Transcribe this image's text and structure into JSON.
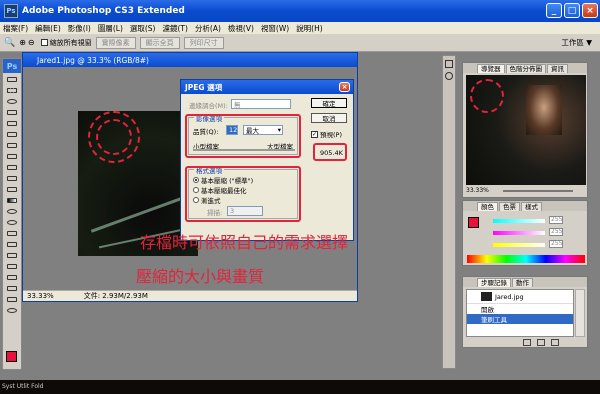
{
  "app": {
    "title": "Adobe Photoshop CS3 Extended"
  },
  "menu": [
    "檔案(F)",
    "編輯(E)",
    "影像(I)",
    "圖層(L)",
    "選取(S)",
    "濾鏡(T)",
    "分析(A)",
    "檢視(V)",
    "視窗(W)",
    "說明(H)"
  ],
  "options": {
    "auto_resize_label": "縮放所有視窗",
    "buttons": [
      "實際像素",
      "顯示全頁",
      "列印尺寸"
    ],
    "workspace": "工作區 ▼"
  },
  "document": {
    "title": "Jared1.jpg @ 33.3% (RGB/8#)",
    "zoom": "33.33%",
    "doc_info": "文件: 2.93M/2.93M"
  },
  "jpeg_dialog": {
    "title": "JPEG 選項",
    "matte_label": "邊緣調合(M):",
    "matte_value": "無",
    "image_options": "影像選項",
    "quality_label": "品質(Q):",
    "quality_value": "12",
    "quality_preset": "最大",
    "small_file": "小型檔案",
    "large_file": "大型檔案",
    "format_options": "格式選項",
    "baseline_standard": "基本壓縮 (\"標準\")",
    "baseline_optimized": "基本壓縮最佳化",
    "progressive": "漸進式",
    "scans_label": "掃描:",
    "scans_value": "3",
    "ok": "確定",
    "cancel": "取消",
    "preview": "預視(P)",
    "file_size": "905.4K"
  },
  "caption": {
    "line1": "存檔時可依照自己的需求選擇",
    "line2": "壓縮的大小與畫質"
  },
  "navigator": {
    "tabs": [
      "導覽器",
      "色階分佈圖",
      "資訊"
    ],
    "zoom": "33.33%"
  },
  "color_panel": {
    "tabs": [
      "顏色",
      "色票",
      "樣式"
    ],
    "values": [
      "255",
      "255",
      "255"
    ],
    "colors": {
      "fg": "#e8133b",
      "accent": "#e2233b"
    }
  },
  "history": {
    "tabs": [
      "步驟記錄",
      "動作"
    ],
    "snapshot": "Jared.jpg",
    "items": [
      "開啟",
      "筆刷工具"
    ]
  },
  "taskbar": {
    "text": "Syst Utlit Fold"
  }
}
